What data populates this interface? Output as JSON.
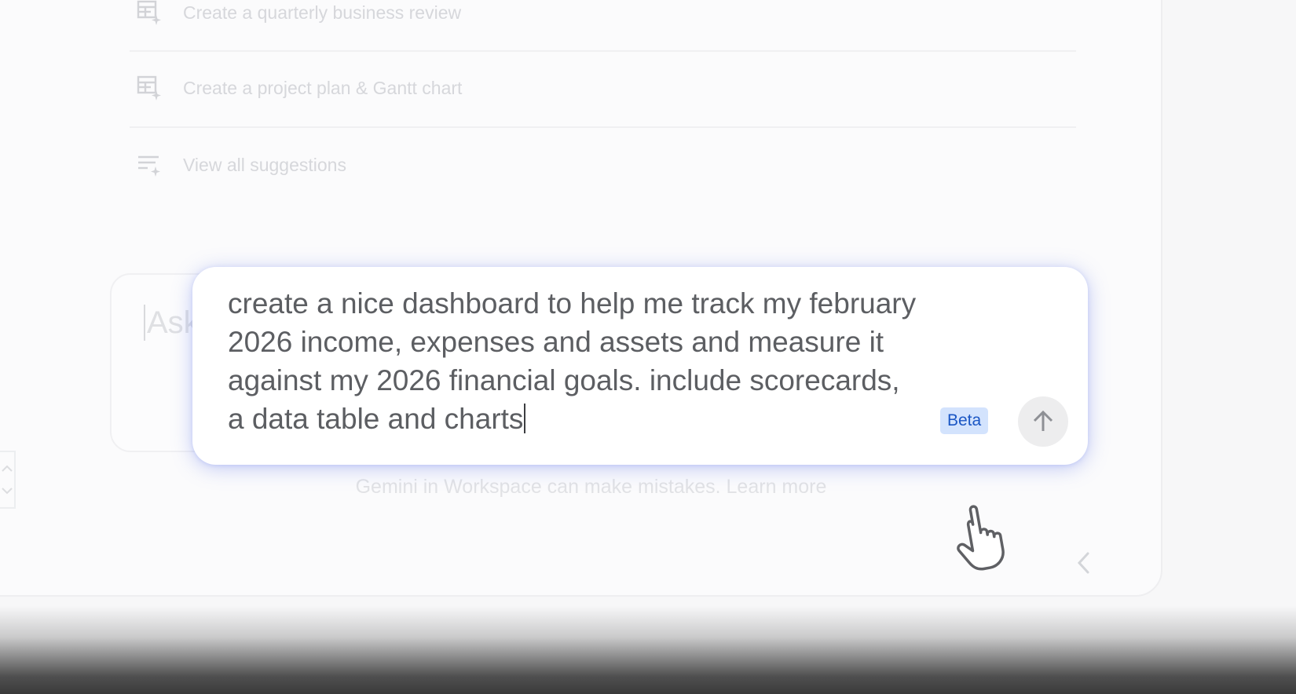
{
  "suggestions": [
    {
      "label": "Create a quarterly business review",
      "icon": "table-sparkle-icon"
    },
    {
      "label": "Create a project plan & Gantt chart",
      "icon": "table-sparkle-icon"
    },
    {
      "label": "View all suggestions",
      "icon": "list-sparkle-icon"
    }
  ],
  "input": {
    "placeholder": "Ask"
  },
  "prompt": {
    "text": "create a nice dashboard to help me track my february\n2026 income, expenses and assets and measure it\nagainst my 2026 financial goals. include scorecards,\na data table and charts",
    "beta_label": "Beta",
    "send_icon": "arrow-up-icon"
  },
  "disclaimer": "Gemini in Workspace can make mistakes. Learn more",
  "colors": {
    "accent_glow": "#6478eb",
    "beta_bg": "#d3e3fd",
    "beta_text": "#1a56c4",
    "faded_text": "#d6d7db"
  }
}
